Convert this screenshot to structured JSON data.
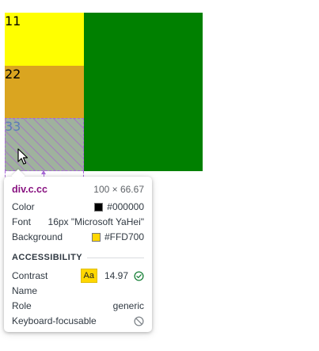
{
  "cells": [
    {
      "text": "11",
      "color": "#FFFF00"
    },
    {
      "text": "22",
      "color": "#DAA520"
    },
    {
      "text": "33",
      "color": "#FFD700"
    }
  ],
  "container_color": "#008000",
  "tooltip": {
    "selector": "div.c.cc",
    "dimensions": "100 × 66.67",
    "rows": {
      "color_label": "Color",
      "color_value": "#000000",
      "font_label": "Font",
      "font_value": "16px \"Microsoft YaHei\"",
      "background_label": "Background",
      "background_value": "#FFD700"
    },
    "accessibility": {
      "title": "ACCESSIBILITY",
      "contrast_label": "Contrast",
      "contrast_badge": "Aa",
      "contrast_value": "14.97",
      "name_label": "Name",
      "name_value": "",
      "role_label": "Role",
      "role_value": "generic",
      "keyboard_label": "Keyboard-focusable"
    },
    "icons": {
      "contrast_status": "check-circle-icon",
      "keyboard_status": "not-allowed-icon"
    }
  }
}
